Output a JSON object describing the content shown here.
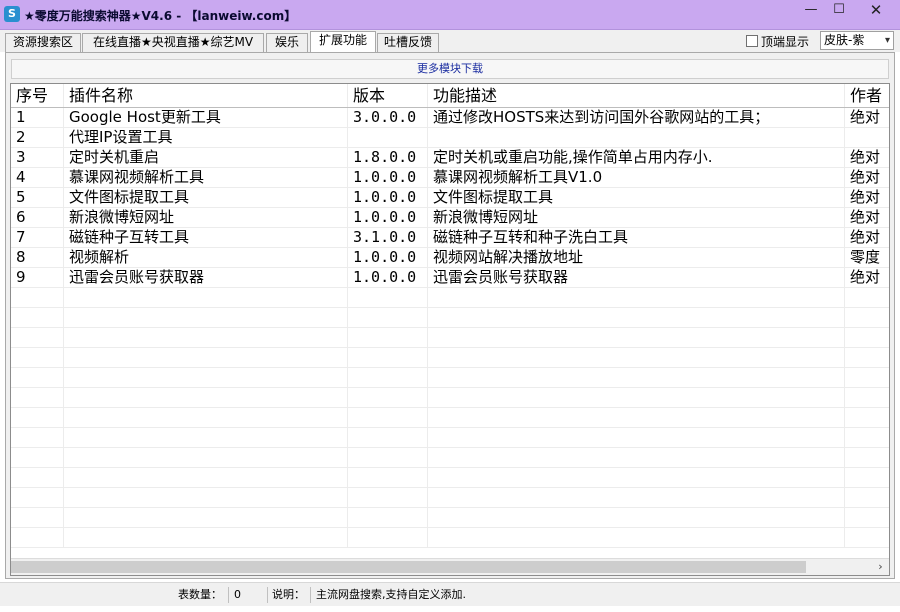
{
  "window": {
    "title": "★零度万能搜索神器★V4.6 - 【lanweiw.com】",
    "icon": "app-logo-icon",
    "controls": {
      "minimize": "—",
      "maximize": "☐",
      "close": "✕"
    }
  },
  "tabs": [
    {
      "label": "资源搜索区"
    },
    {
      "label": "在线直播★央视直播★综艺MV"
    },
    {
      "label": "娱乐"
    },
    {
      "label": "扩展功能",
      "active": true
    },
    {
      "label": "吐槽反馈"
    }
  ],
  "topmost": {
    "label": "顶端显示",
    "checked": false
  },
  "skin": {
    "value": "皮肤-紫",
    "arrow": "▾"
  },
  "more_modules": "更多模块下载",
  "table": {
    "headers": [
      "序号",
      "插件名称",
      "版本",
      "功能描述",
      "作者"
    ],
    "rows": [
      [
        "1",
        "Google Host更新工具",
        "3.0.0.0",
        "通过修改HOSTS来达到访问国外谷歌网站的工具；",
        "绝对"
      ],
      [
        "2",
        "代理IP设置工具",
        "",
        "",
        ""
      ],
      [
        "3",
        "定时关机重启",
        "1.8.0.0",
        "定时关机或重启功能,操作简单占用内存小.",
        "绝对"
      ],
      [
        "4",
        "慕课网视频解析工具",
        "1.0.0.0",
        "慕课网视频解析工具V1.0",
        "绝对"
      ],
      [
        "5",
        "文件图标提取工具",
        "1.0.0.0",
        "文件图标提取工具",
        "绝对"
      ],
      [
        "6",
        "新浪微博短网址",
        "1.0.0.0",
        "新浪微博短网址",
        "绝对"
      ],
      [
        "7",
        "磁链种子互转工具",
        "3.1.0.0",
        "磁链种子互转和种子洗白工具",
        "绝对"
      ],
      [
        "8",
        "视频解析",
        "1.0.0.0",
        "视频网站解决播放地址",
        "零度"
      ],
      [
        "9",
        "迅雷会员账号获取器",
        "1.0.0.0",
        "迅雷会员账号获取器",
        "绝对"
      ]
    ]
  },
  "scrollbar": {
    "right_arrow": "›"
  },
  "status": {
    "count_label": "表数量：",
    "count_value": "0",
    "desc_label": "说明：",
    "desc_value": "主流网盘搜索,支持自定义添加."
  }
}
